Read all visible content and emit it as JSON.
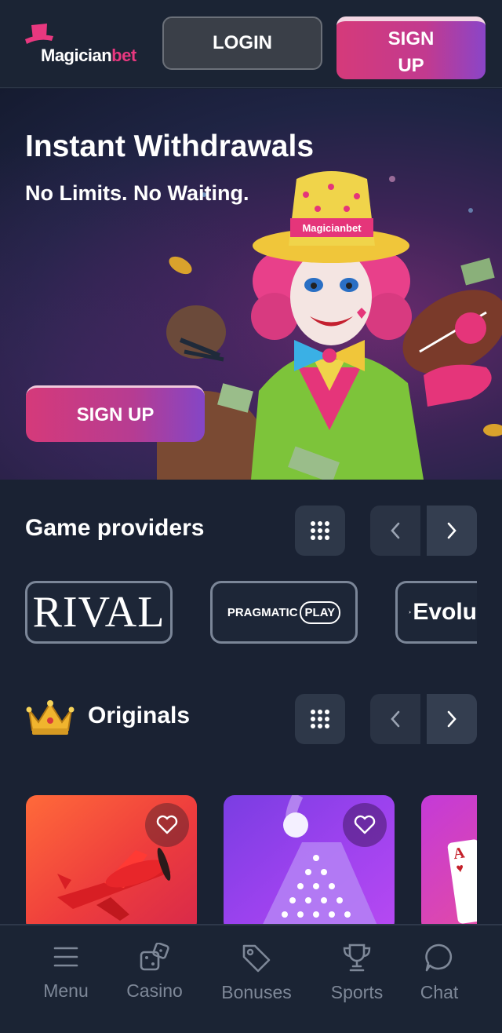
{
  "header": {
    "logo": {
      "text_main": "Magician",
      "text_accent": "bet"
    },
    "login_label": "LOGIN",
    "signup_label_line1": "SIGN",
    "signup_label_line2": "UP"
  },
  "hero": {
    "title": "Instant Withdrawals",
    "subtitle": "No Limits. No Waiting.",
    "cta_label": "SIGN UP",
    "hat_band_text": "Magicianbet"
  },
  "providers": {
    "title": "Game providers",
    "items": [
      {
        "name": "RIVAL"
      },
      {
        "name": "PRAGMATIC",
        "name_suffix": "PLAY"
      },
      {
        "name": "Evolu"
      }
    ]
  },
  "originals": {
    "title": "Originals",
    "card_icons": [
      "plane-icon",
      "plinko-icon",
      "playing-card-icon"
    ],
    "third_card_text": "A"
  },
  "bottom_nav": {
    "items": [
      {
        "label": "Menu",
        "icon": "menu-icon"
      },
      {
        "label": "Casino",
        "icon": "dice-icon"
      },
      {
        "label": "Bonuses",
        "icon": "tag-icon"
      },
      {
        "label": "Sports",
        "icon": "trophy-icon"
      },
      {
        "label": "Chat",
        "icon": "chat-icon"
      }
    ]
  },
  "colors": {
    "background": "#1a2233",
    "accent_pink": "#d53a7a",
    "accent_purple": "#8a45c8",
    "muted_text": "#7e8898"
  }
}
